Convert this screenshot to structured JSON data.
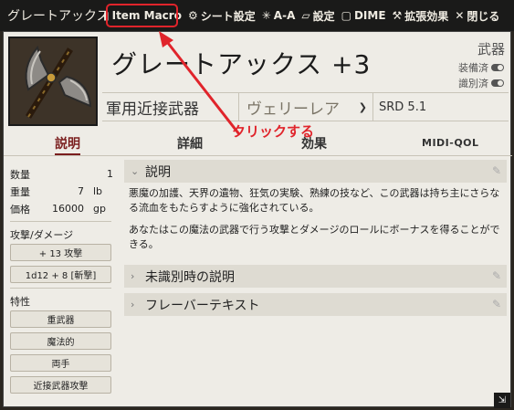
{
  "titlebar": {
    "title": "グレートアックス",
    "buttons": [
      {
        "label": "Item Macro",
        "icon": "file-icon"
      },
      {
        "label": "シート設定",
        "icon": "gear-icon"
      },
      {
        "label": "A-A",
        "icon": "spark-icon"
      },
      {
        "label": "設定",
        "icon": "folder-icon"
      },
      {
        "label": "DIME",
        "icon": "dice-icon"
      },
      {
        "label": "拡張効果",
        "icon": "wrench-icon"
      },
      {
        "label": "閉じる",
        "icon": "close-icon"
      }
    ]
  },
  "header": {
    "name": "グレートアックス +3",
    "type": "武器",
    "equipped_label": "装備済",
    "identified_label": "識別済",
    "weapon_class": "軍用近接武器",
    "rarity": "ヴェリーレア",
    "source": "SRD 5.1"
  },
  "tabs": [
    {
      "label": "説明"
    },
    {
      "label": "詳細"
    },
    {
      "label": "効果"
    },
    {
      "label": "Midi-qol"
    }
  ],
  "sidebar": {
    "props": [
      {
        "label": "数量",
        "value": "1"
      },
      {
        "label": "重量",
        "value": "7",
        "unit": "lb"
      },
      {
        "label": "価格",
        "value": "16000",
        "unit": "gp"
      }
    ],
    "attack_heading": "攻撃/ダメージ",
    "attack_buttons": [
      "+ 13 攻撃",
      "1d12 + 8 [斬撃]"
    ],
    "traits_heading": "特性",
    "traits": [
      "重武器",
      "魔法的",
      "両手",
      "近接武器攻撃"
    ]
  },
  "content": {
    "sections": [
      {
        "title": "説明",
        "expanded": true
      },
      {
        "title": "未識別時の説明",
        "expanded": false
      },
      {
        "title": "フレーバーテキスト",
        "expanded": false
      }
    ],
    "description": [
      "悪魔の加護、天界の遺物、狂気の実験、熟練の技など、この武器は持ち主にさらなる流血をもたらすように強化されている。",
      "あなたはこの魔法の武器で行う攻撃とダメージのロールにボーナスを得ることができる。"
    ]
  },
  "annotation": {
    "text": "クリックする",
    "color": "#e0242b"
  },
  "colors": {
    "accent": "#7a1e1e",
    "titlebar": "#1a1a19",
    "sheet_bg": "#eeece6"
  }
}
